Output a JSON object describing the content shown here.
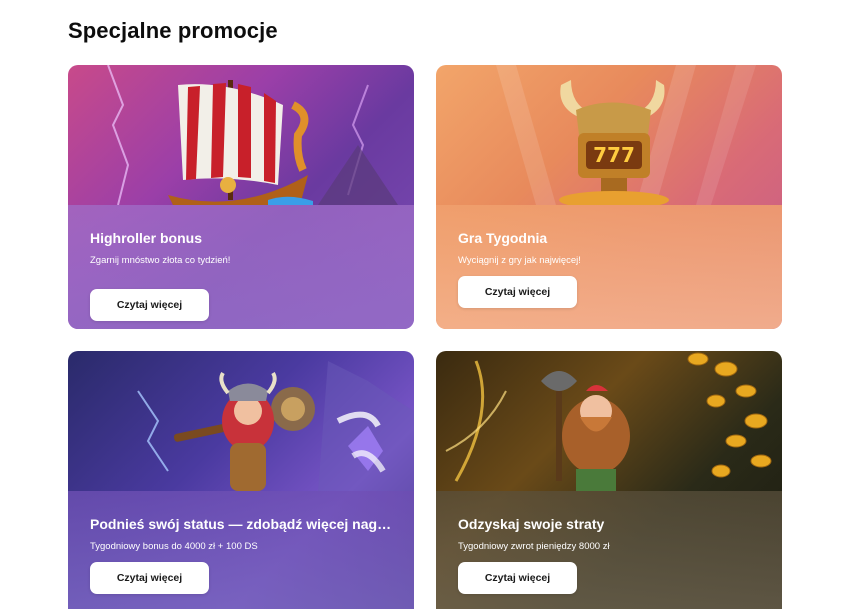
{
  "section": {
    "title": "Specjalne promocje"
  },
  "cards": [
    {
      "title": "Highroller bonus",
      "desc": "Zgarnij mnóstwo złota co tydzień!",
      "button": "Czytaj więcej",
      "art": "viking-ship-illustration"
    },
    {
      "title": "Gra Tygodnia",
      "desc": "Wyciągnij z gry jak najwięcej!",
      "button": "Czytaj więcej",
      "art": "horned-777-trophy-illustration"
    },
    {
      "title": "Podnieś swój status — zdobądź więcej nagr...",
      "desc": "Tygodniowy bonus do 4000 zł + 100 DS",
      "button": "Czytaj więcej",
      "art": "viking-warrior-woman-illustration"
    },
    {
      "title": "Odzyskaj swoje straty",
      "desc": "Tygodniowy zwrot pieniędzy 8000 zł",
      "button": "Czytaj więcej",
      "art": "dwarf-gold-coins-illustration"
    }
  ]
}
